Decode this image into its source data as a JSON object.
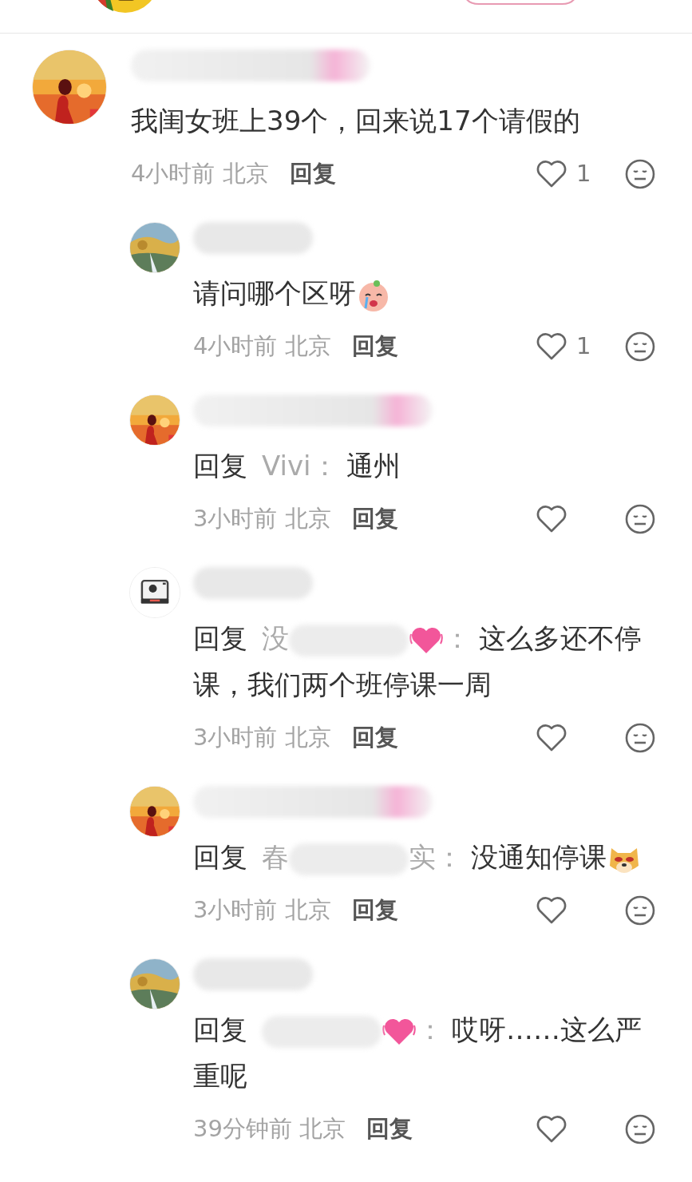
{
  "comments": [
    {
      "avatar": {
        "kind": "sunset"
      },
      "name_tinted": true,
      "body": [
        {
          "kind": "text",
          "text": "我闺女班上39个，回来说17个请假的"
        }
      ],
      "time": "4小时前",
      "location": "北京",
      "reply_action": "回复",
      "likes": "1",
      "replies": [
        {
          "avatar": {
            "kind": "landscape"
          },
          "name_tinted": false,
          "body": [
            {
              "kind": "text",
              "text": "请问哪个区呀"
            },
            {
              "kind": "emoji",
              "emoji": {
                "kind": "crying"
              }
            }
          ],
          "time": "4小时前",
          "location": "北京",
          "reply_action": "回复",
          "likes": "1"
        },
        {
          "avatar": {
            "kind": "sunset"
          },
          "name_tinted": true,
          "body": [
            {
              "kind": "label",
              "text": "回复"
            },
            {
              "kind": "target",
              "text": "Vivi："
            },
            {
              "kind": "text",
              "text": "通州"
            }
          ],
          "time": "3小时前",
          "location": "北京",
          "reply_action": "回复"
        },
        {
          "avatar": {
            "kind": "camera"
          },
          "name_tinted": false,
          "body": [
            {
              "kind": "label",
              "text": "回复"
            },
            {
              "kind": "target",
              "text": "没"
            },
            {
              "kind": "blur"
            },
            {
              "kind": "emoji",
              "emoji": {
                "kind": "heart"
              }
            },
            {
              "kind": "target",
              "text": "："
            },
            {
              "kind": "text",
              "text": "这么多还不停课，我们两个班停课一周"
            }
          ],
          "time": "3小时前",
          "location": "北京",
          "reply_action": "回复"
        },
        {
          "avatar": {
            "kind": "sunset"
          },
          "name_tinted": true,
          "body": [
            {
              "kind": "label",
              "text": "回复"
            },
            {
              "kind": "target",
              "text": "春"
            },
            {
              "kind": "blur"
            },
            {
              "kind": "target",
              "text": "实："
            },
            {
              "kind": "text",
              "text": "没通知停课"
            },
            {
              "kind": "emoji",
              "emoji": {
                "kind": "dog"
              }
            }
          ],
          "time": "3小时前",
          "location": "北京",
          "reply_action": "回复"
        },
        {
          "avatar": {
            "kind": "landscape"
          },
          "name_tinted": false,
          "body": [
            {
              "kind": "label",
              "text": "回复"
            },
            {
              "kind": "blur"
            },
            {
              "kind": "emoji",
              "emoji": {
                "kind": "heart"
              }
            },
            {
              "kind": "target",
              "text": "："
            },
            {
              "kind": "text",
              "text": "哎呀……这么严重呢"
            }
          ],
          "time": "39分钟前",
          "location": "北京",
          "reply_action": "回复"
        }
      ]
    }
  ]
}
